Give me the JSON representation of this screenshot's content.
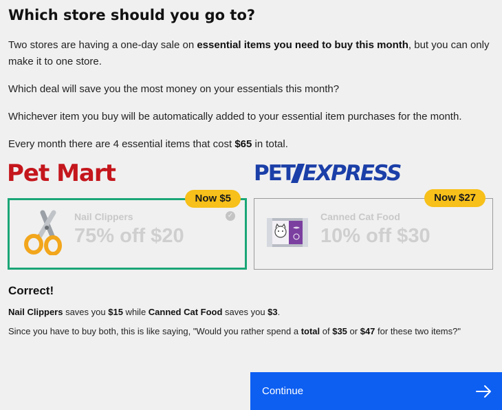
{
  "title": "Which store should you go to?",
  "intro": {
    "p1_a": "Two stores are having a one-day sale on ",
    "p1_b": "essential items you need to buy this month",
    "p1_c": ", but you can only make it to one store.",
    "p2": "Which deal will save you the most money on your essentials this month?",
    "p3": "Whichever item you buy will be automatically added to your essential item purchases for the month.",
    "p4_a": "Every month there are 4 essential items that cost ",
    "p4_b": "$65",
    "p4_c": " in total."
  },
  "stores": [
    {
      "logo": "Pet Mart",
      "badge": "Now $5",
      "item": "Nail Clippers",
      "deal": "75% off $20",
      "icon": "scissors-icon",
      "selected": true
    },
    {
      "logo_a": "PET",
      "logo_b": "EXPRESS",
      "badge": "Now $27",
      "item": "Canned Cat Food",
      "deal": "10% off $30",
      "icon": "cat-food-can-icon",
      "selected": false
    }
  ],
  "feedback": {
    "heading": "Correct!",
    "s1_a": "Nail Clippers",
    "s1_b": " saves you ",
    "s1_c": "$15",
    "s1_d": " while ",
    "s1_e": "Canned Cat Food",
    "s1_f": " saves you ",
    "s1_g": "$3",
    "s1_h": ".",
    "s2_a": "Since you have to buy both, this is like saying, \"Would you rather spend a ",
    "s2_b": "total",
    "s2_c": " of ",
    "s2_d": "$35",
    "s2_e": " or ",
    "s2_f": "$47",
    "s2_g": " for these two items?\""
  },
  "continue_label": "Continue",
  "colors": {
    "correct_border": "#1aa677",
    "badge": "#f7c01a",
    "continue": "#0d5ff2",
    "petmart": "#c4161c",
    "petexpress": "#1b3fa8"
  }
}
